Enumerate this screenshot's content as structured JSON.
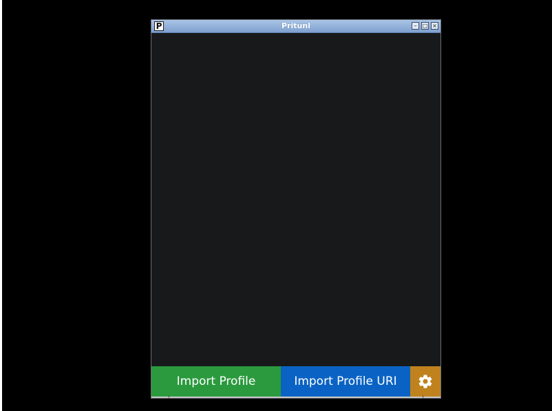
{
  "window": {
    "title": "Pritunl",
    "app_icon_letter": "P",
    "controls": {
      "minimize_glyph": "–",
      "maximize_glyph": "□",
      "close_glyph": "×"
    }
  },
  "toolbar": {
    "import_profile_label": "Import Profile",
    "import_profile_uri_label": "Import Profile URI",
    "settings_icon": "gear-icon"
  },
  "colors": {
    "import_profile": "#2b9a3e",
    "import_profile_uri": "#0a63c4",
    "settings": "#c0821d",
    "content_background": "#18191b"
  }
}
